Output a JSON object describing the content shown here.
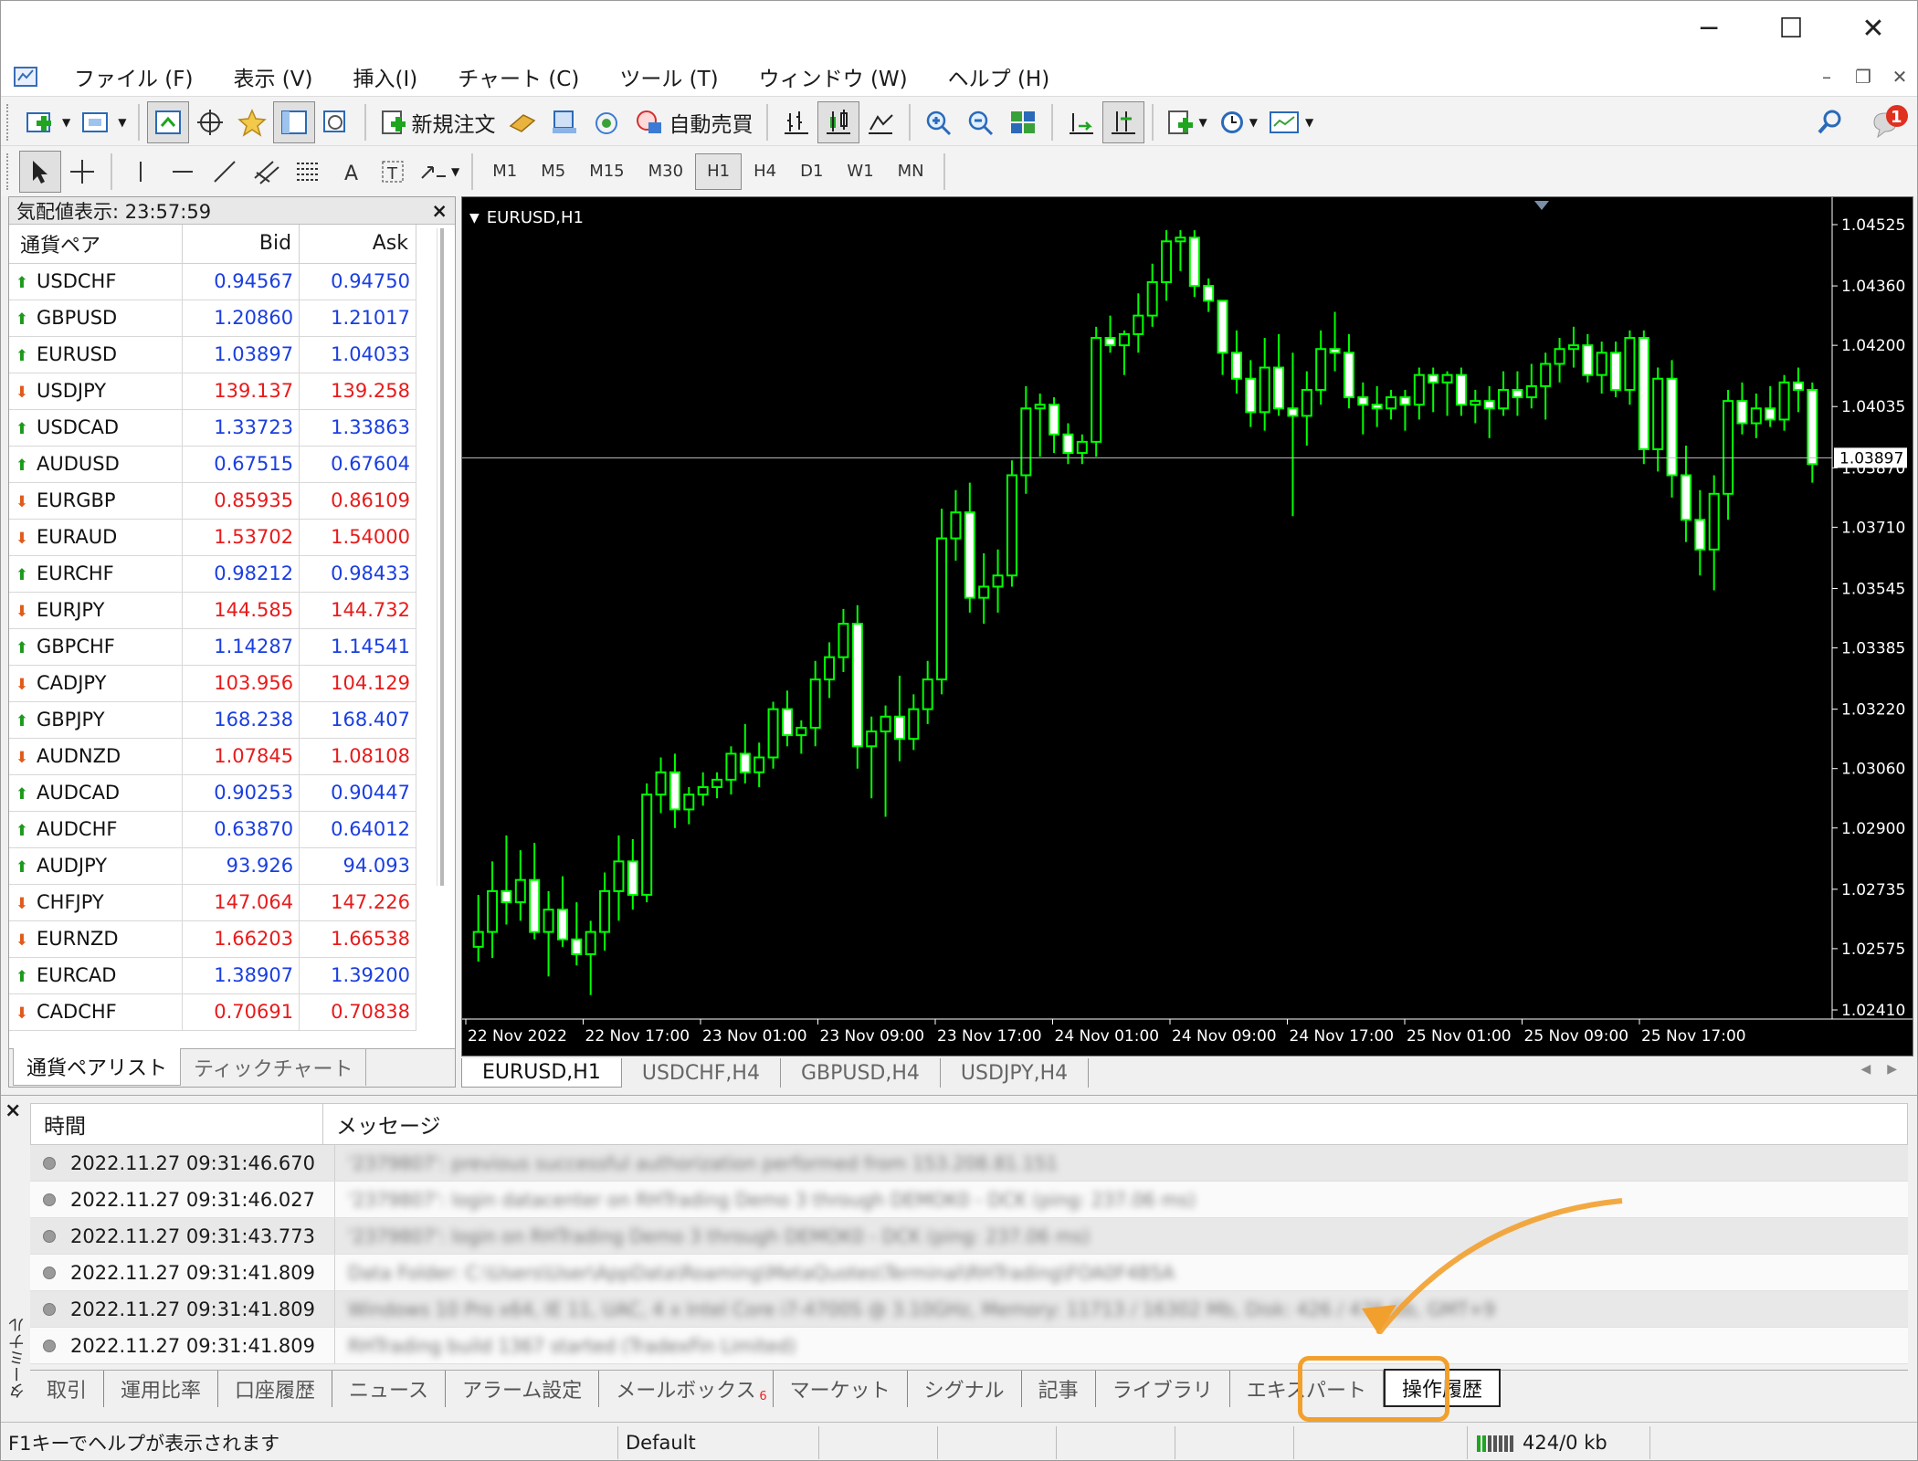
{
  "window": {
    "minimize": "─",
    "maximize": "☐",
    "close": "✕"
  },
  "menu": [
    "ファイル (F)",
    "表示 (V)",
    "挿入(I)",
    "チャート (C)",
    "ツール (T)",
    "ウィンドウ (W)",
    "ヘルプ (H)"
  ],
  "toolbar": {
    "new_order": "新規注文",
    "auto_trading": "自動売買",
    "notification_count": "1"
  },
  "timeframes": [
    "M1",
    "M5",
    "M15",
    "M30",
    "H1",
    "H4",
    "D1",
    "W1",
    "MN"
  ],
  "active_timeframe": "H1",
  "market_watch": {
    "title": "気配値表示: 23:57:59",
    "close": "×",
    "columns": [
      "通貨ペア",
      "Bid",
      "Ask"
    ],
    "rows": [
      {
        "symbol": "USDCHF",
        "bid": "0.94567",
        "ask": "0.94750",
        "dir": "up"
      },
      {
        "symbol": "GBPUSD",
        "bid": "1.20860",
        "ask": "1.21017",
        "dir": "up"
      },
      {
        "symbol": "EURUSD",
        "bid": "1.03897",
        "ask": "1.04033",
        "dir": "up"
      },
      {
        "symbol": "USDJPY",
        "bid": "139.137",
        "ask": "139.258",
        "dir": "down"
      },
      {
        "symbol": "USDCAD",
        "bid": "1.33723",
        "ask": "1.33863",
        "dir": "up"
      },
      {
        "symbol": "AUDUSD",
        "bid": "0.67515",
        "ask": "0.67604",
        "dir": "up"
      },
      {
        "symbol": "EURGBP",
        "bid": "0.85935",
        "ask": "0.86109",
        "dir": "down"
      },
      {
        "symbol": "EURAUD",
        "bid": "1.53702",
        "ask": "1.54000",
        "dir": "down"
      },
      {
        "symbol": "EURCHF",
        "bid": "0.98212",
        "ask": "0.98433",
        "dir": "up"
      },
      {
        "symbol": "EURJPY",
        "bid": "144.585",
        "ask": "144.732",
        "dir": "down"
      },
      {
        "symbol": "GBPCHF",
        "bid": "1.14287",
        "ask": "1.14541",
        "dir": "up"
      },
      {
        "symbol": "CADJPY",
        "bid": "103.956",
        "ask": "104.129",
        "dir": "down"
      },
      {
        "symbol": "GBPJPY",
        "bid": "168.238",
        "ask": "168.407",
        "dir": "up"
      },
      {
        "symbol": "AUDNZD",
        "bid": "1.07845",
        "ask": "1.08108",
        "dir": "down"
      },
      {
        "symbol": "AUDCAD",
        "bid": "0.90253",
        "ask": "0.90447",
        "dir": "up"
      },
      {
        "symbol": "AUDCHF",
        "bid": "0.63870",
        "ask": "0.64012",
        "dir": "up"
      },
      {
        "symbol": "AUDJPY",
        "bid": "93.926",
        "ask": "94.093",
        "dir": "up"
      },
      {
        "symbol": "CHFJPY",
        "bid": "147.064",
        "ask": "147.226",
        "dir": "down"
      },
      {
        "symbol": "EURNZD",
        "bid": "1.66203",
        "ask": "1.66538",
        "dir": "down"
      },
      {
        "symbol": "EURCAD",
        "bid": "1.38907",
        "ask": "1.39200",
        "dir": "up"
      },
      {
        "symbol": "CADCHF",
        "bid": "0.70691",
        "ask": "0.70838",
        "dir": "down"
      }
    ],
    "tabs": [
      "通貨ペアリスト",
      "ティックチャート"
    ]
  },
  "chart": {
    "symbol_label": "EURUSD,H1",
    "current_price": "1.03897",
    "price_labels": [
      "1.04525",
      "1.04360",
      "1.04200",
      "1.04035",
      "1.03870",
      "1.03710",
      "1.03545",
      "1.03385",
      "1.03220",
      "1.03060",
      "1.02900",
      "1.02735",
      "1.02575",
      "1.02410"
    ],
    "time_labels": [
      "22 Nov 2022",
      "22 Nov 17:00",
      "23 Nov 01:00",
      "23 Nov 09:00",
      "23 Nov 17:00",
      "24 Nov 01:00",
      "24 Nov 09:00",
      "24 Nov 17:00",
      "25 Nov 01:00",
      "25 Nov 09:00",
      "25 Nov 17:00"
    ],
    "bull_color": "#00ff00",
    "bear_color": "#ffffff",
    "background": "#000000"
  },
  "chart_tabs": [
    "EURUSD,H1",
    "USDCHF,H4",
    "GBPUSD,H4",
    "USDJPY,H4"
  ],
  "chart_data": {
    "type": "candlestick",
    "ylim": [
      1.0241,
      1.04525
    ],
    "candles": [
      [
        1.0258,
        1.0272,
        1.0254,
        1.0262
      ],
      [
        1.0262,
        1.0281,
        1.0255,
        1.0273
      ],
      [
        1.0273,
        1.0288,
        1.0264,
        1.027
      ],
      [
        1.027,
        1.0284,
        1.0265,
        1.0276
      ],
      [
        1.0276,
        1.0286,
        1.026,
        1.0262
      ],
      [
        1.0262,
        1.0273,
        1.025,
        1.0268
      ],
      [
        1.0268,
        1.0277,
        1.0258,
        1.026
      ],
      [
        1.026,
        1.027,
        1.0253,
        1.0256
      ],
      [
        1.0256,
        1.0265,
        1.0245,
        1.0262
      ],
      [
        1.0262,
        1.0278,
        1.0257,
        1.0273
      ],
      [
        1.0273,
        1.0288,
        1.0265,
        1.0281
      ],
      [
        1.0281,
        1.0287,
        1.0268,
        1.0272
      ],
      [
        1.0272,
        1.0302,
        1.027,
        1.0299
      ],
      [
        1.0299,
        1.0309,
        1.0294,
        1.0305
      ],
      [
        1.0305,
        1.031,
        1.029,
        1.0295
      ],
      [
        1.0295,
        1.0301,
        1.0291,
        1.0299
      ],
      [
        1.0299,
        1.0305,
        1.0296,
        1.0301
      ],
      [
        1.0301,
        1.0305,
        1.0298,
        1.0303
      ],
      [
        1.0303,
        1.0312,
        1.0299,
        1.031
      ],
      [
        1.031,
        1.0318,
        1.0302,
        1.0305
      ],
      [
        1.0305,
        1.0313,
        1.0301,
        1.0309
      ],
      [
        1.0309,
        1.0324,
        1.0306,
        1.0322
      ],
      [
        1.0322,
        1.0327,
        1.0312,
        1.0315
      ],
      [
        1.0315,
        1.0319,
        1.031,
        1.0317
      ],
      [
        1.0317,
        1.0335,
        1.0312,
        1.033
      ],
      [
        1.033,
        1.034,
        1.0325,
        1.0336
      ],
      [
        1.0336,
        1.0349,
        1.0332,
        1.0345
      ],
      [
        1.0345,
        1.035,
        1.0306,
        1.0312
      ],
      [
        1.0312,
        1.032,
        1.0298,
        1.0316
      ],
      [
        1.0316,
        1.0323,
        1.0293,
        1.032
      ],
      [
        1.032,
        1.0331,
        1.0308,
        1.0314
      ],
      [
        1.0314,
        1.0326,
        1.0311,
        1.0322
      ],
      [
        1.0322,
        1.0335,
        1.0318,
        1.033
      ],
      [
        1.033,
        1.0376,
        1.0326,
        1.0368
      ],
      [
        1.0368,
        1.0381,
        1.0362,
        1.0375
      ],
      [
        1.0375,
        1.0383,
        1.0348,
        1.0352
      ],
      [
        1.0352,
        1.0364,
        1.0345,
        1.0355
      ],
      [
        1.0355,
        1.0365,
        1.0348,
        1.0358
      ],
      [
        1.0358,
        1.0389,
        1.0355,
        1.0385
      ],
      [
        1.0385,
        1.0409,
        1.038,
        1.0403
      ],
      [
        1.0403,
        1.0407,
        1.039,
        1.0404
      ],
      [
        1.0404,
        1.0406,
        1.0391,
        1.0396
      ],
      [
        1.0396,
        1.0399,
        1.0388,
        1.0391
      ],
      [
        1.0391,
        1.0396,
        1.0388,
        1.0394
      ],
      [
        1.0394,
        1.0425,
        1.039,
        1.0422
      ],
      [
        1.0422,
        1.0428,
        1.0418,
        1.042
      ],
      [
        1.042,
        1.0424,
        1.0412,
        1.0423
      ],
      [
        1.0423,
        1.0434,
        1.0418,
        1.0428
      ],
      [
        1.0428,
        1.0442,
        1.0425,
        1.0437
      ],
      [
        1.0437,
        1.0451,
        1.0432,
        1.0448
      ],
      [
        1.0448,
        1.0451,
        1.044,
        1.0449
      ],
      [
        1.0449,
        1.0451,
        1.0433,
        1.0436
      ],
      [
        1.0436,
        1.0438,
        1.0429,
        1.0432
      ],
      [
        1.0432,
        1.043,
        1.0412,
        1.0418
      ],
      [
        1.0418,
        1.0424,
        1.0407,
        1.0411
      ],
      [
        1.0411,
        1.0416,
        1.0398,
        1.0402
      ],
      [
        1.0402,
        1.0422,
        1.0397,
        1.0414
      ],
      [
        1.0414,
        1.0423,
        1.0401,
        1.0403
      ],
      [
        1.0403,
        1.0418,
        1.0374,
        1.0401
      ],
      [
        1.0401,
        1.0413,
        1.0393,
        1.0408
      ],
      [
        1.0408,
        1.0424,
        1.0404,
        1.0419
      ],
      [
        1.0419,
        1.0429,
        1.0413,
        1.0418
      ],
      [
        1.0418,
        1.0423,
        1.0403,
        1.0406
      ],
      [
        1.0406,
        1.041,
        1.0396,
        1.0404
      ],
      [
        1.0404,
        1.0409,
        1.0398,
        1.0403
      ],
      [
        1.0403,
        1.0408,
        1.04,
        1.0406
      ],
      [
        1.0406,
        1.0408,
        1.0397,
        1.0404
      ],
      [
        1.0404,
        1.0414,
        1.04,
        1.0412
      ],
      [
        1.0412,
        1.0414,
        1.0402,
        1.041
      ],
      [
        1.041,
        1.0413,
        1.0401,
        1.0412
      ],
      [
        1.0412,
        1.0414,
        1.0401,
        1.0404
      ],
      [
        1.0404,
        1.0408,
        1.0399,
        1.0405
      ],
      [
        1.0405,
        1.0409,
        1.0395,
        1.0403
      ],
      [
        1.0403,
        1.0413,
        1.0401,
        1.0408
      ],
      [
        1.0408,
        1.0413,
        1.0401,
        1.0406
      ],
      [
        1.0406,
        1.0415,
        1.0403,
        1.0409
      ],
      [
        1.0409,
        1.0418,
        1.04,
        1.0415
      ],
      [
        1.0415,
        1.0422,
        1.041,
        1.0419
      ],
      [
        1.0419,
        1.0425,
        1.0414,
        1.042
      ],
      [
        1.042,
        1.0423,
        1.041,
        1.0412
      ],
      [
        1.0412,
        1.0421,
        1.0407,
        1.0418
      ],
      [
        1.0418,
        1.0421,
        1.0406,
        1.0408
      ],
      [
        1.0408,
        1.0424,
        1.0404,
        1.0422
      ],
      [
        1.0422,
        1.0424,
        1.0388,
        1.0392
      ],
      [
        1.0392,
        1.0414,
        1.0386,
        1.0411
      ],
      [
        1.0411,
        1.0416,
        1.0379,
        1.0385
      ],
      [
        1.0385,
        1.0393,
        1.0367,
        1.0373
      ],
      [
        1.0373,
        1.0381,
        1.0358,
        1.0365
      ],
      [
        1.0365,
        1.0385,
        1.0354,
        1.038
      ],
      [
        1.038,
        1.0408,
        1.0373,
        1.0405
      ],
      [
        1.0405,
        1.041,
        1.0396,
        1.0399
      ],
      [
        1.0399,
        1.0407,
        1.0395,
        1.0403
      ],
      [
        1.0403,
        1.0409,
        1.0398,
        1.04
      ],
      [
        1.04,
        1.0412,
        1.0397,
        1.041
      ],
      [
        1.041,
        1.0414,
        1.0402,
        1.0408
      ],
      [
        1.0408,
        1.041,
        1.0383,
        1.0388
      ]
    ]
  },
  "terminal": {
    "close": "×",
    "side_label": "ターミナル",
    "columns": [
      "時間",
      "メッセージ"
    ],
    "rows": [
      {
        "time": "2022.11.27 09:31:46.670",
        "msg": "'2379807': previous successful authorization performed from 153.208.81.151"
      },
      {
        "time": "2022.11.27 09:31:46.027",
        "msg": "'2379807': login datacenter on RHTrading Demo 3 through DEMOK0 - DCK (ping: 237.06 ms)"
      },
      {
        "time": "2022.11.27 09:31:43.773",
        "msg": "'2379807': login on RHTrading Demo 3 through DEMOK0 - DCK (ping: 237.06 ms)"
      },
      {
        "time": "2022.11.27 09:31:41.809",
        "msg": "Data Folder: C:\\Users\\User\\AppData\\Roaming\\MetaQuotes\\Terminal\\RHTrading\\FOA0F4B5A"
      },
      {
        "time": "2022.11.27 09:31:41.809",
        "msg": "Windows 10 Pro x64, IE 11, UAC, 4 x Intel Core i7-4700S @ 3.10GHz, Memory: 11713 / 16302 Mb, Disk: 426 / 476 Gb, GMT+9"
      },
      {
        "time": "2022.11.27 09:31:41.809",
        "msg": "RHTrading build 1367 started (TradexFin Limited)"
      }
    ],
    "tabs": [
      {
        "label": "取引",
        "badge": ""
      },
      {
        "label": "運用比率",
        "badge": ""
      },
      {
        "label": "口座履歴",
        "badge": ""
      },
      {
        "label": "ニュース",
        "badge": ""
      },
      {
        "label": "アラーム設定",
        "badge": ""
      },
      {
        "label": "メールボックス",
        "badge": "6"
      },
      {
        "label": "マーケット",
        "badge": ""
      },
      {
        "label": "シグナル",
        "badge": ""
      },
      {
        "label": "記事",
        "badge": ""
      },
      {
        "label": "ライブラリ",
        "badge": ""
      },
      {
        "label": "エキスパート",
        "badge": ""
      },
      {
        "label": "操作履歴",
        "badge": ""
      }
    ],
    "active_tab": "操作履歴"
  },
  "status": {
    "help": "F1キーでヘルプが表示されます",
    "profile": "Default",
    "traffic": "424/0 kb"
  },
  "highlight_color": "#f2a02d"
}
